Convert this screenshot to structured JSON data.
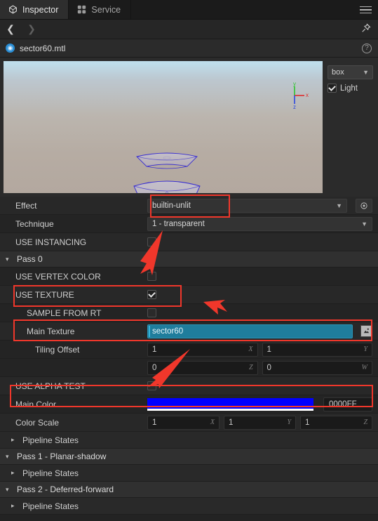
{
  "tabs": [
    {
      "label": "Inspector",
      "icon": "cube-icon",
      "active": true
    },
    {
      "label": "Service",
      "icon": "grid-dots-icon",
      "active": false
    }
  ],
  "menu_icon": "hamburger-icon",
  "nav": {
    "back_icon": "chevron-left-icon",
    "forward_icon": "chevron-right-icon",
    "pin_icon": "pin-icon"
  },
  "asset": {
    "name": "sector60.mtl",
    "icon": "material-ball-icon",
    "help_icon": "help-circle-icon"
  },
  "preview": {
    "shape_select": "box",
    "shape_chevron": "chevron-down-icon",
    "light_label": "Light",
    "light_checked": true,
    "gizmo": {
      "x": "x",
      "y": "y",
      "z": "z",
      "x_color": "#e02b2b",
      "y_color": "#2ec42e",
      "z_color": "#2b47e0"
    }
  },
  "properties": {
    "effect": {
      "label": "Effect",
      "value": "builtin-unlit",
      "locate_icon": "target-icon"
    },
    "technique": {
      "label": "Technique",
      "value": "1 - transparent"
    },
    "use_instancing": {
      "label": "USE INSTANCING",
      "checked": false
    }
  },
  "pass0": {
    "header": "Pass 0",
    "use_vertex_color": {
      "label": "USE VERTEX COLOR",
      "checked": false
    },
    "use_texture": {
      "label": "USE TEXTURE",
      "checked": true
    },
    "sample_from_rt": {
      "label": "SAMPLE FROM RT",
      "checked": false
    },
    "main_texture": {
      "label": "Main Texture",
      "value": "sector60",
      "thumb_icon": "texture-thumbnail-icon"
    },
    "tiling_offset": {
      "label": "Tiling Offset",
      "x": {
        "value": "1",
        "axis": "X"
      },
      "y": {
        "value": "1",
        "axis": "Y"
      },
      "z": {
        "value": "0",
        "axis": "Z"
      },
      "w": {
        "value": "0",
        "axis": "W"
      }
    },
    "use_alpha_test": {
      "label": "USE ALPHA TEST",
      "checked": false
    },
    "main_color": {
      "label": "Main Color",
      "swatch": "#0000FF",
      "hex": "0000FF"
    },
    "color_scale": {
      "label": "Color Scale",
      "x": {
        "value": "1",
        "axis": "X"
      },
      "y": {
        "value": "1",
        "axis": "Y"
      },
      "z": {
        "value": "1",
        "axis": "Z"
      }
    },
    "pipeline_states": "Pipeline States"
  },
  "pass1": {
    "header": "Pass 1 - Planar-shadow",
    "pipeline_states": "Pipeline States"
  },
  "pass2": {
    "header": "Pass 2 - Deferred-forward",
    "pipeline_states": "Pipeline States"
  },
  "annotation_color": "#f0372b"
}
